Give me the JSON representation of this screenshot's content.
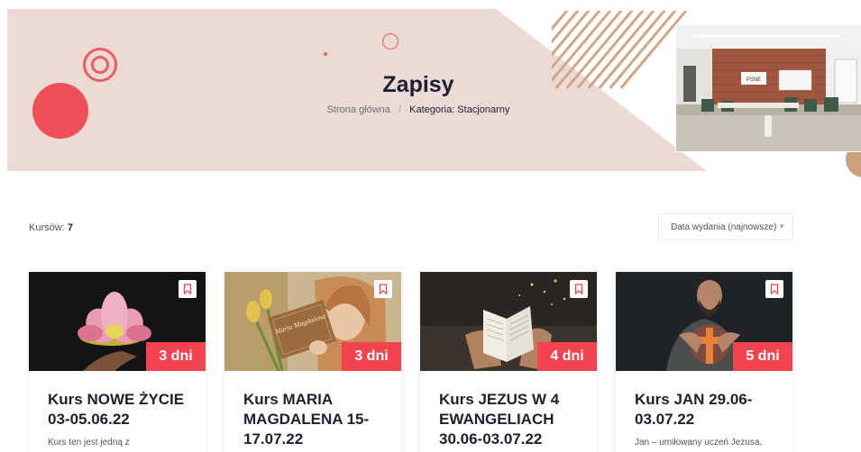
{
  "hero": {
    "title": "Zapisy",
    "breadcrumb": {
      "home": "Strona główna",
      "separator": "/",
      "current": "Kategoria: Stacjonarny"
    },
    "room_sign": "PSNE"
  },
  "listing": {
    "count_label": "Kursów:",
    "count_value": "7",
    "sort_value": "Data wydania (najnowsze)"
  },
  "colors": {
    "accent": "#f2434f",
    "hero_bg": "#ecdbd4",
    "stripe": "#d2a586"
  },
  "courses": [
    {
      "title": "Kurs NOWE ŻYCIE 03-05.06.22",
      "days": "3 dni",
      "desc": "Kurs ten jest jedną z"
    },
    {
      "title": "Kurs MARIA MAGDALENA 15-17.07.22",
      "days": "3 dni",
      "desc": "",
      "book_label": "Maria Magdalena"
    },
    {
      "title": "Kurs JEZUS W 4 EWANGELIACH 30.06-03.07.22",
      "days": "4 dni",
      "desc": ""
    },
    {
      "title": "Kurs JAN 29.06-03.07.22",
      "days": "5 dni",
      "desc": "Jan – umiłowany uczeń Jezusa,"
    }
  ]
}
